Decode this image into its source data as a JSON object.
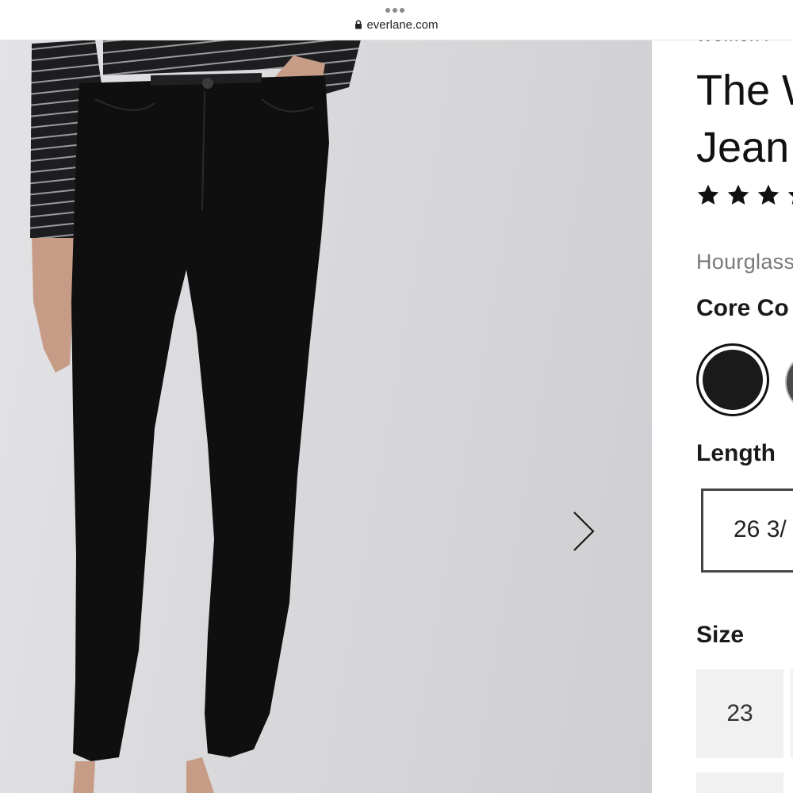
{
  "browser": {
    "url": "everlane.com",
    "icons": [
      "more-dots-icon",
      "lock-icon"
    ]
  },
  "gallery": {
    "image_description_icon": "product-photo",
    "next_icon": "chevron-right-icon"
  },
  "product": {
    "breadcrumb": "Women /",
    "title_line1": "The W",
    "title_line2": "Jean",
    "rating_stars": 4,
    "fit": "Hourglass",
    "color_label": "Core Co",
    "colors": [
      "#1a1a1a",
      "#4a4a4a"
    ],
    "length_label": "Length",
    "length_selected": "26 3/",
    "size_label": "Size",
    "sizes": [
      "23"
    ]
  }
}
